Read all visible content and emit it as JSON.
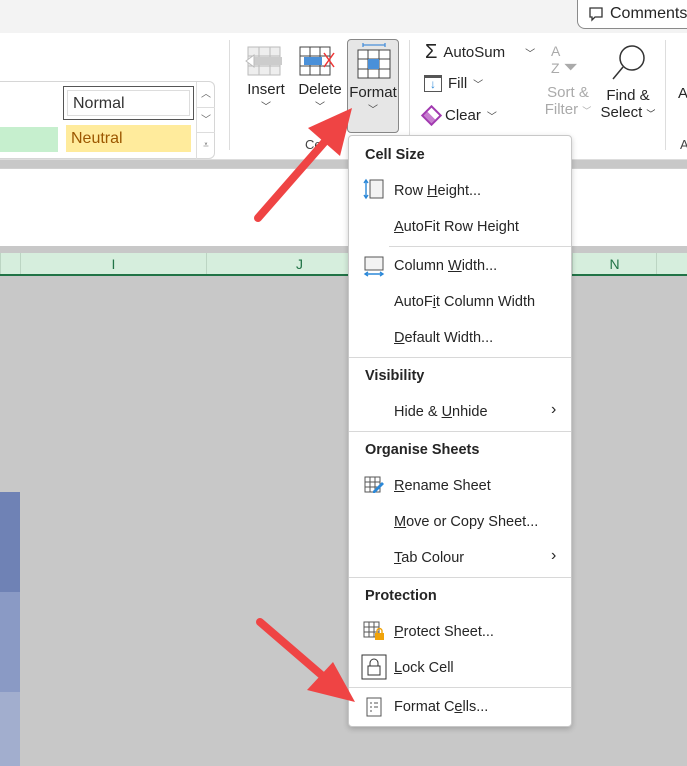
{
  "topbar": {
    "comments_label": "Comments"
  },
  "styles": {
    "normal": "Normal",
    "neutral": "Neutral"
  },
  "cells": {
    "insert": "Insert",
    "delete": "Delete",
    "format": "Format",
    "group_label_partial": "Ce"
  },
  "editing": {
    "autosum": "AutoSum",
    "fill": "Fill",
    "clear": "Clear",
    "sort_filter_1": "Sort &",
    "sort_filter_2": "Filter",
    "find_select_1": "Find &",
    "find_select_2": "Select",
    "next_partial": "A",
    "next_group_partial": "A"
  },
  "columns": [
    "I",
    "J",
    "N"
  ],
  "menu": {
    "cell_size": "Cell Size",
    "row_height": {
      "pre": "Row ",
      "key": "H",
      "post": "eight..."
    },
    "autofit_row": {
      "pre": "",
      "key": "A",
      "post": "utoFit Row Height"
    },
    "column_width": {
      "pre": "Column ",
      "key": "W",
      "post": "idth..."
    },
    "autofit_col": {
      "pre": "AutoF",
      "key": "i",
      "post": "t Column Width"
    },
    "default_width": {
      "pre": "",
      "key": "D",
      "post": "efault Width..."
    },
    "visibility": "Visibility",
    "hide_unhide": {
      "pre": "Hide & ",
      "key": "U",
      "post": "nhide"
    },
    "organise": "Organise Sheets",
    "rename": {
      "pre": "",
      "key": "R",
      "post": "ename Sheet"
    },
    "move_copy": {
      "pre": "",
      "key": "M",
      "post": "ove or Copy Sheet..."
    },
    "tab_colour": {
      "pre": "",
      "key": "T",
      "post": "ab Colour"
    },
    "protection": "Protection",
    "protect_sheet": {
      "pre": "",
      "key": "P",
      "post": "rotect Sheet..."
    },
    "lock_cell": {
      "pre": "",
      "key": "L",
      "post": "ock Cell"
    },
    "format_cells": {
      "pre": "Format C",
      "key": "e",
      "post": "lls..."
    }
  },
  "colors": {
    "accent": "#217346",
    "arrow": "#ef4444",
    "neutral_bg": "#ffeb9c",
    "good_bg": "#c6efce"
  }
}
